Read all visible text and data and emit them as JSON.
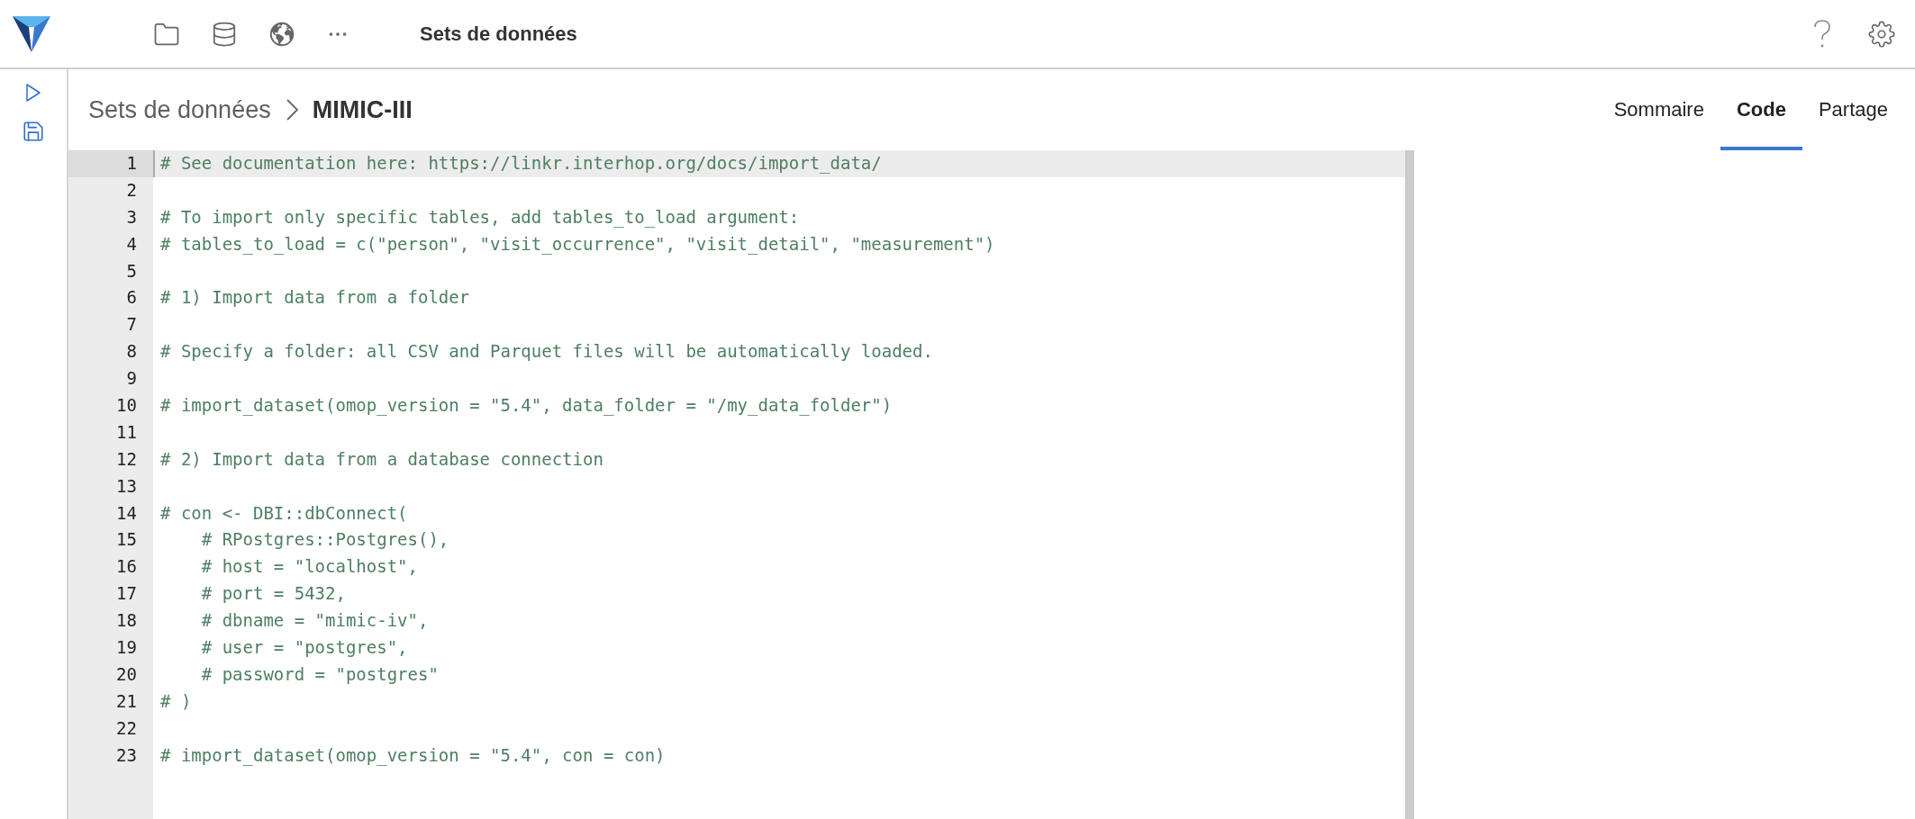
{
  "header": {
    "title": "Sets de données",
    "toolbar": [
      {
        "kind": "folder"
      },
      {
        "kind": "database"
      },
      {
        "kind": "globe"
      },
      {
        "kind": "more"
      }
    ],
    "actions": [
      {
        "kind": "help"
      },
      {
        "kind": "settings"
      }
    ]
  },
  "sidebar": {
    "items": [
      {
        "kind": "run"
      },
      {
        "kind": "save"
      }
    ]
  },
  "breadcrumb": {
    "parent": "Sets de données",
    "current": "MIMIC-III"
  },
  "tabs": [
    {
      "label": "Sommaire",
      "selected": false
    },
    {
      "label": "Code",
      "selected": true
    },
    {
      "label": "Partage",
      "selected": false
    }
  ],
  "editor": {
    "lines": [
      {
        "number": "1",
        "text": "# See documentation here: https://linkr.interhop.org/docs/import_data/",
        "active": true
      },
      {
        "number": "2",
        "active": false
      },
      {
        "number": "3",
        "text": "# To import only specific tables, add tables_to_load argument:",
        "active": false
      },
      {
        "number": "4",
        "text": "# tables_to_load = c(\"person\", \"visit_occurrence\", \"visit_detail\", \"measurement\")",
        "active": false
      },
      {
        "number": "5",
        "active": false
      },
      {
        "number": "6",
        "text": "# 1) Import data from a folder",
        "active": false
      },
      {
        "number": "7",
        "active": false
      },
      {
        "number": "8",
        "text": "# Specify a folder: all CSV and Parquet files will be automatically loaded.",
        "active": false
      },
      {
        "number": "9",
        "active": false
      },
      {
        "number": "10",
        "text": "# import_dataset(omop_version = \"5.4\", data_folder = \"/my_data_folder\")",
        "active": false
      },
      {
        "number": "11",
        "active": false
      },
      {
        "number": "12",
        "text": "# 2) Import data from a database connection",
        "active": false
      },
      {
        "number": "13",
        "active": false
      },
      {
        "number": "14",
        "text": "# con <- DBI::dbConnect(",
        "active": false
      },
      {
        "number": "15",
        "text": "    # RPostgres::Postgres(),",
        "active": false
      },
      {
        "number": "16",
        "text": "    # host = \"localhost\",",
        "active": false
      },
      {
        "number": "17",
        "text": "    # port = 5432,",
        "active": false
      },
      {
        "number": "18",
        "text": "    # dbname = \"mimic-iv\",",
        "active": false
      },
      {
        "number": "19",
        "text": "    # user = \"postgres\",",
        "active": false
      },
      {
        "number": "20",
        "text": "    # password = \"postgres\"",
        "active": false
      },
      {
        "number": "21",
        "text": "# )",
        "active": false
      },
      {
        "number": "22",
        "active": false
      },
      {
        "number": "23",
        "text": "# import_dataset(omop_version = \"5.4\", con = con)",
        "active": false
      }
    ]
  }
}
